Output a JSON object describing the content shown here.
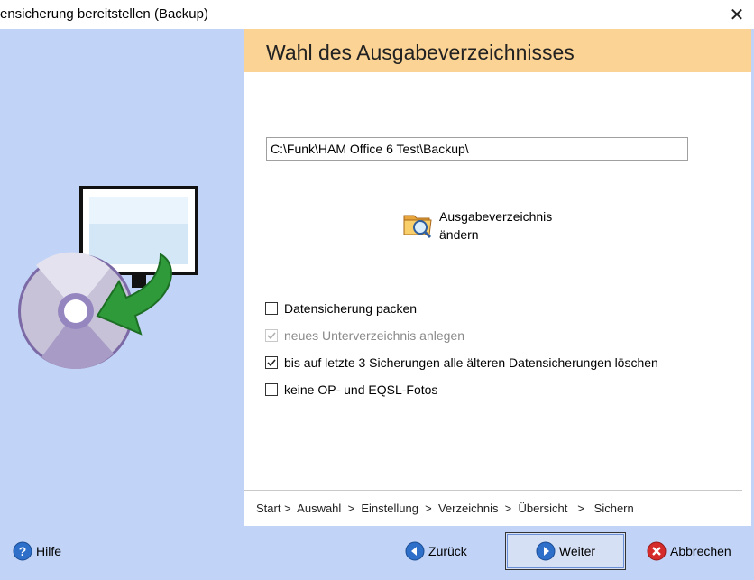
{
  "window": {
    "title": "ensicherung bereitstellen (Backup)",
    "close_label": "✕"
  },
  "page": {
    "title": "Wahl des Ausgabeverzeichnisses",
    "output_path": "C:\\Funk\\HAM Office 6 Test\\Backup\\",
    "change_dir_line1": "Ausgabeverzeichnis",
    "change_dir_line2": "ändern"
  },
  "options": [
    {
      "label": "Datensicherung packen",
      "checked": false,
      "enabled": true
    },
    {
      "label": "neues Unterverzeichnis anlegen",
      "checked": true,
      "enabled": false
    },
    {
      "label": "bis auf letzte 3 Sicherungen alle älteren Datensicherungen löschen",
      "checked": true,
      "enabled": true
    },
    {
      "label": "keine OP- und EQSL-Fotos",
      "checked": false,
      "enabled": true
    }
  ],
  "breadcrumb": {
    "steps": [
      "Start",
      "Auswahl",
      "Einstellung",
      "Verzeichnis",
      "Übersicht",
      "Sichern"
    ],
    "text": "Start >  Auswahl  >  Einstellung  >  Verzeichnis  >  Übersicht   >   Sichern"
  },
  "buttons": {
    "help_mnemonic": "H",
    "help_rest": "ilfe",
    "back_mnemonic": "Z",
    "back_rest": "urück",
    "next": "Weiter",
    "cancel": "Abbrechen"
  },
  "icons": {
    "help": "question-icon",
    "back": "arrow-left-icon",
    "next": "arrow-right-icon",
    "cancel": "x-circle-icon",
    "folder": "folder-search-icon",
    "illustration": "monitor-cd-backup-icon"
  },
  "colors": {
    "side_panel": "#c1d3f6",
    "header_band": "#fbd394",
    "accent_blue": "#2d6fc9",
    "cancel_red": "#d52b2b"
  }
}
